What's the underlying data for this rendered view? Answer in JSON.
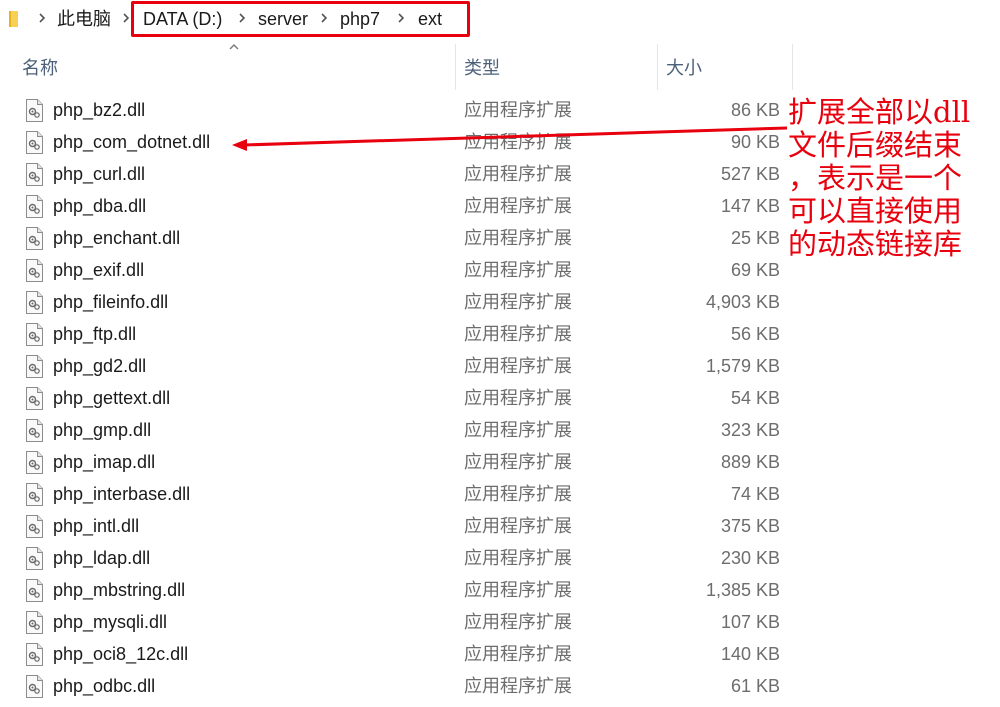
{
  "address_bar": {
    "crumbs": [
      "此电脑",
      "DATA (D:)",
      "server",
      "php7",
      "ext"
    ]
  },
  "columns": {
    "name": "名称",
    "type": "类型",
    "size": "大小"
  },
  "files": [
    {
      "name": "php_bz2.dll",
      "type": "应用程序扩展",
      "size": "86 KB"
    },
    {
      "name": "php_com_dotnet.dll",
      "type": "应用程序扩展",
      "size": "90 KB"
    },
    {
      "name": "php_curl.dll",
      "type": "应用程序扩展",
      "size": "527 KB"
    },
    {
      "name": "php_dba.dll",
      "type": "应用程序扩展",
      "size": "147 KB"
    },
    {
      "name": "php_enchant.dll",
      "type": "应用程序扩展",
      "size": "25 KB"
    },
    {
      "name": "php_exif.dll",
      "type": "应用程序扩展",
      "size": "69 KB"
    },
    {
      "name": "php_fileinfo.dll",
      "type": "应用程序扩展",
      "size": "4,903 KB"
    },
    {
      "name": "php_ftp.dll",
      "type": "应用程序扩展",
      "size": "56 KB"
    },
    {
      "name": "php_gd2.dll",
      "type": "应用程序扩展",
      "size": "1,579 KB"
    },
    {
      "name": "php_gettext.dll",
      "type": "应用程序扩展",
      "size": "54 KB"
    },
    {
      "name": "php_gmp.dll",
      "type": "应用程序扩展",
      "size": "323 KB"
    },
    {
      "name": "php_imap.dll",
      "type": "应用程序扩展",
      "size": "889 KB"
    },
    {
      "name": "php_interbase.dll",
      "type": "应用程序扩展",
      "size": "74 KB"
    },
    {
      "name": "php_intl.dll",
      "type": "应用程序扩展",
      "size": "375 KB"
    },
    {
      "name": "php_ldap.dll",
      "type": "应用程序扩展",
      "size": "230 KB"
    },
    {
      "name": "php_mbstring.dll",
      "type": "应用程序扩展",
      "size": "1,385 KB"
    },
    {
      "name": "php_mysqli.dll",
      "type": "应用程序扩展",
      "size": "107 KB"
    },
    {
      "name": "php_oci8_12c.dll",
      "type": "应用程序扩展",
      "size": "140 KB"
    },
    {
      "name": "php_odbc.dll",
      "type": "应用程序扩展",
      "size": "61 KB"
    }
  ],
  "annotation": {
    "lines": [
      "扩展全部以dll",
      "文件后缀结束",
      "，表示是一个",
      "可以直接使用",
      "的动态链接库"
    ]
  },
  "colors": {
    "highlight_red": "#e8000e",
    "header_text": "#4c607a",
    "secondary_text": "#6d6d6d"
  },
  "icons": {
    "folder": "folder-icon",
    "breadcrumb_separator": "chevron-right-icon",
    "file": "dll-file-icon",
    "sort": "sort-up-icon"
  }
}
